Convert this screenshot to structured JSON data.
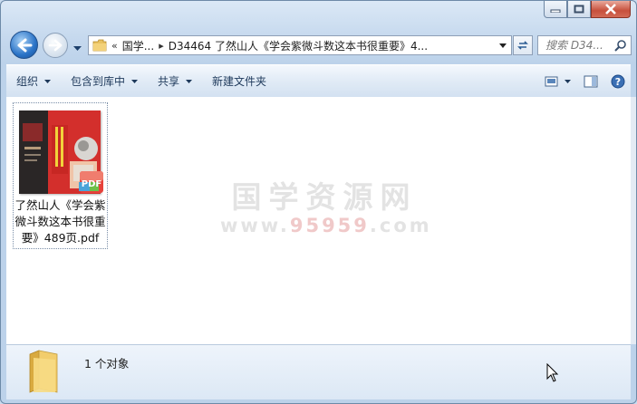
{
  "address": {
    "overflow_chevron": "«",
    "crumbs": [
      "国学...",
      "D34464 了然山人《学会紫微斗数这本书很重要》4..."
    ]
  },
  "search": {
    "placeholder": "搜索 D34..."
  },
  "toolbar": {
    "organize": "组织",
    "include_in_library": "包含到库中",
    "share": "共享",
    "new_folder": "新建文件夹"
  },
  "files": [
    {
      "name": "了然山人《学会紫微斗数这本书很重要》489页.pdf",
      "badge": "PDF"
    }
  ],
  "watermark": {
    "title": "国学资源网",
    "url_prefix": "www.",
    "url_num": "95959",
    "url_suffix": ".com"
  },
  "details": {
    "count": "1 个对象"
  },
  "icons": [
    "back-arrow-icon",
    "forward-arrow-icon",
    "folder-icon",
    "refresh-icon",
    "search-icon",
    "view-options-icon",
    "preview-pane-icon",
    "help-icon",
    "pdf-icon",
    "minimize-icon",
    "maximize-icon",
    "close-icon"
  ],
  "colors": {
    "accent": "#2a73c7",
    "close": "#c7503c",
    "thumb_red": "#d9302f"
  }
}
